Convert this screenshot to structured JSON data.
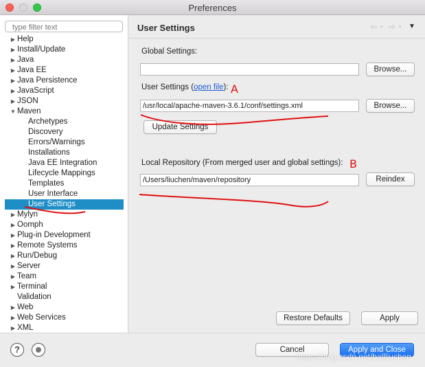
{
  "window": {
    "title": "Preferences"
  },
  "filter": {
    "placeholder": "type filter text"
  },
  "tree": [
    {
      "label": "Help",
      "toggle": "▶",
      "level": 0
    },
    {
      "label": "Install/Update",
      "toggle": "▶",
      "level": 0
    },
    {
      "label": "Java",
      "toggle": "▶",
      "level": 0
    },
    {
      "label": "Java EE",
      "toggle": "▶",
      "level": 0
    },
    {
      "label": "Java Persistence",
      "toggle": "▶",
      "level": 0
    },
    {
      "label": "JavaScript",
      "toggle": "▶",
      "level": 0
    },
    {
      "label": "JSON",
      "toggle": "▶",
      "level": 0
    },
    {
      "label": "Maven",
      "toggle": "▼",
      "level": 0
    },
    {
      "label": "Archetypes",
      "toggle": "",
      "level": 1
    },
    {
      "label": "Discovery",
      "toggle": "",
      "level": 1
    },
    {
      "label": "Errors/Warnings",
      "toggle": "",
      "level": 1
    },
    {
      "label": "Installations",
      "toggle": "",
      "level": 1
    },
    {
      "label": "Java EE Integration",
      "toggle": "",
      "level": 1
    },
    {
      "label": "Lifecycle Mappings",
      "toggle": "",
      "level": 1
    },
    {
      "label": "Templates",
      "toggle": "",
      "level": 1
    },
    {
      "label": "User Interface",
      "toggle": "",
      "level": 1
    },
    {
      "label": "User Settings",
      "toggle": "",
      "level": 1,
      "selected": true
    },
    {
      "label": "Mylyn",
      "toggle": "▶",
      "level": 0
    },
    {
      "label": "Oomph",
      "toggle": "▶",
      "level": 0
    },
    {
      "label": "Plug-in Development",
      "toggle": "▶",
      "level": 0
    },
    {
      "label": "Remote Systems",
      "toggle": "▶",
      "level": 0
    },
    {
      "label": "Run/Debug",
      "toggle": "▶",
      "level": 0
    },
    {
      "label": "Server",
      "toggle": "▶",
      "level": 0
    },
    {
      "label": "Team",
      "toggle": "▶",
      "level": 0
    },
    {
      "label": "Terminal",
      "toggle": "▶",
      "level": 0
    },
    {
      "label": "Validation",
      "toggle": "",
      "level": 0
    },
    {
      "label": "Web",
      "toggle": "▶",
      "level": 0
    },
    {
      "label": "Web Services",
      "toggle": "▶",
      "level": 0
    },
    {
      "label": "XML",
      "toggle": "▶",
      "level": 0
    }
  ],
  "page": {
    "title": "User Settings",
    "global_label": "Global Settings:",
    "global_value": "",
    "browse_label": "Browse...",
    "user_label_prefix": "User Settings (",
    "user_label_link": "open file",
    "user_label_suffix": "):",
    "user_value": "/usr/local/apache-maven-3.6.1/conf/settings.xml",
    "update_label": "Update Settings",
    "local_repo_label": "Local Repository (From merged user and global settings):",
    "local_repo_value": "/Users/liuchen/maven/repository",
    "reindex_label": "Reindex",
    "annotation_a": "A",
    "annotation_b": "B",
    "restore_label": "Restore Defaults",
    "apply_label": "Apply"
  },
  "footer": {
    "cancel_label": "Cancel",
    "apply_close_label": "Apply and Close",
    "watermark": "https://blog.csdn.net/ballliuchen",
    "help_glyph": "?"
  },
  "colors": {
    "selection": "#1f8ec6",
    "link": "#1759d1",
    "annotation": "#e01010",
    "primary_button": "#1d72f0"
  },
  "icons": [
    "back-arrow-icon",
    "forward-arrow-icon",
    "menu-chevron-icon",
    "help-icon",
    "preferences-link-icon"
  ]
}
